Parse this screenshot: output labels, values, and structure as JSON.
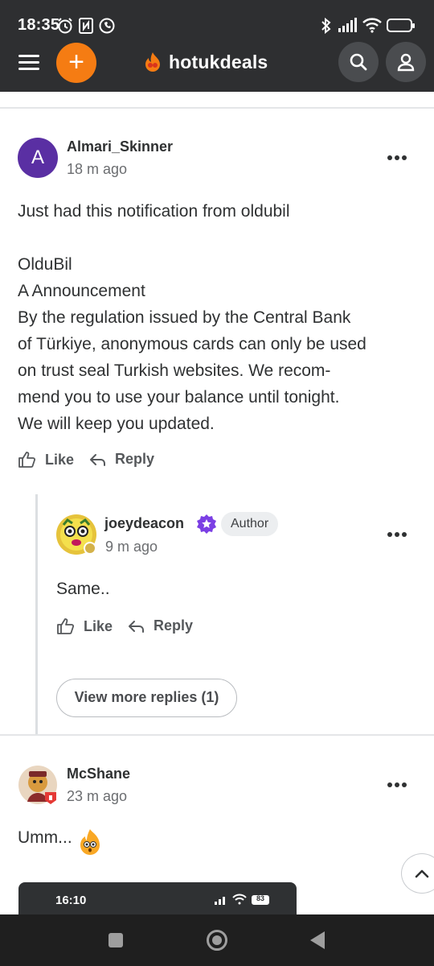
{
  "status_bar": {
    "time": "18:35",
    "battery": "73",
    "icons": [
      "alarm-icon",
      "nfc-icon",
      "whatsapp-icon",
      "bluetooth-icon",
      "signal-icon",
      "wifi-icon",
      "battery-icon"
    ]
  },
  "header": {
    "brand": "hotukdeals",
    "brand_color": "#f57c13",
    "icons": [
      "menu-icon",
      "plus-icon",
      "flame-logo-icon",
      "search-icon",
      "user-icon"
    ]
  },
  "comments": [
    {
      "avatar_letter": "A",
      "username": "Almari_Skinner",
      "time": "18 m ago",
      "body": "Just had this notification from oldubil\n\nOlduBil\nA Announcement\nBy the regulation issued by the Central Bank\nof Türkiye, anonymous cards can only be used\non trust seal Turkish websites. We recom-\nmend you to use your balance until tonight.\nWe will keep you updated.",
      "like_label": "Like",
      "reply_label": "Reply",
      "reply": {
        "username": "joeydeacon",
        "badge": "Author",
        "time": "9 m ago",
        "body": "Same..",
        "like_label": "Like",
        "reply_label": "Reply",
        "view_more": "View more replies (1)"
      }
    },
    {
      "username": "McShane",
      "time": "23 m ago",
      "body": "Umm..."
    }
  ],
  "embedded_screenshot": {
    "time": "16:10",
    "battery": "83"
  },
  "accent_purple": "#5a2fa3"
}
